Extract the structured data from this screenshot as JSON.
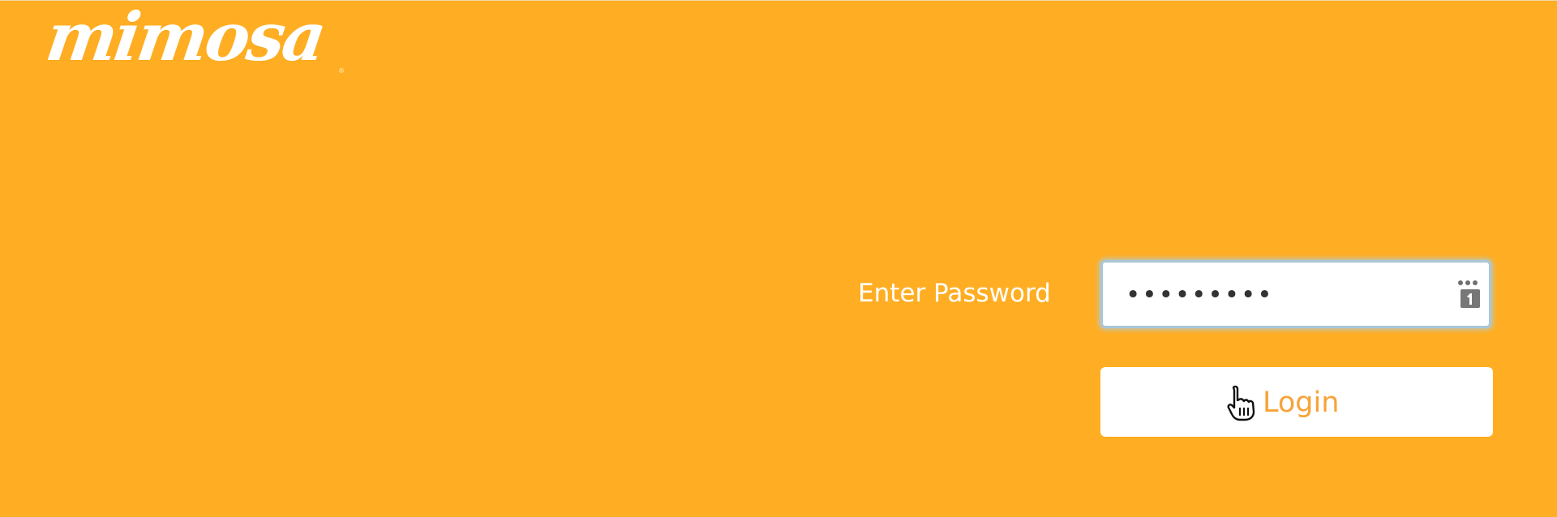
{
  "brand": {
    "logo_text": "mimosa",
    "registered_mark": "®"
  },
  "login_form": {
    "password_label": "Enter Password",
    "password_value": "•••••••••",
    "login_label": "Login"
  },
  "icons": {
    "password_manager": "password-manager-icon",
    "cursor": "pointer-cursor-icon"
  },
  "colors": {
    "background": "#ffae23",
    "white": "#ffffff",
    "login_text": "#f7a338",
    "focus_border": "#a9c7d9"
  }
}
